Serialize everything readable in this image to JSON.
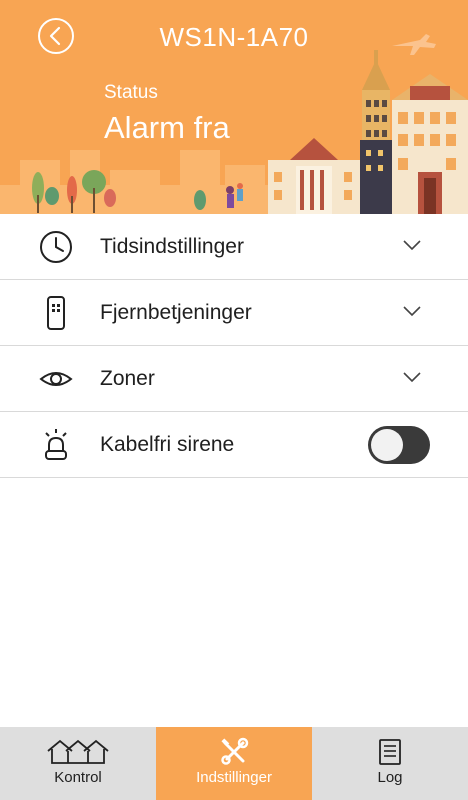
{
  "header": {
    "title": "WS1N-1A70",
    "status_label": "Status",
    "status_value": "Alarm fra"
  },
  "settings": {
    "items": [
      {
        "label": "Tidsindstillinger",
        "icon": "clock-icon",
        "control": "chevron"
      },
      {
        "label": "Fjernbetjeninger",
        "icon": "remote-control-icon",
        "control": "chevron"
      },
      {
        "label": "Zoner",
        "icon": "eye-icon",
        "control": "chevron"
      },
      {
        "label": "Kabelfri sirene",
        "icon": "siren-icon",
        "control": "toggle",
        "toggle_on": false
      }
    ]
  },
  "bottom_nav": {
    "items": [
      {
        "label": "Kontrol",
        "icon": "houses-icon",
        "active": false
      },
      {
        "label": "Indstillinger",
        "icon": "tools-icon",
        "active": true
      },
      {
        "label": "Log",
        "icon": "log-icon",
        "active": false
      }
    ]
  },
  "colors": {
    "accent": "#f8a553",
    "nav_background": "#dedede",
    "toggle_off": "#3a3a3a"
  }
}
